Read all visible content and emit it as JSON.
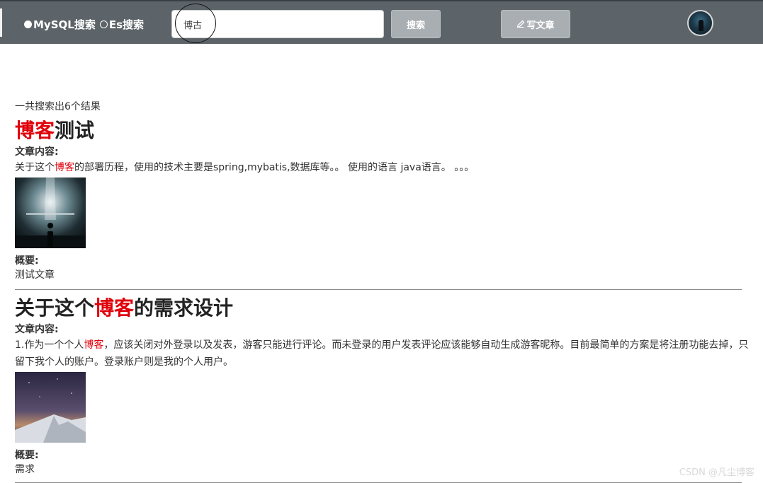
{
  "navbar": {
    "mode_options": [
      {
        "label": "MySQL搜索",
        "selected": true
      },
      {
        "label": "Es搜索",
        "selected": false
      }
    ],
    "search_value": "博古",
    "search_button": "搜索",
    "write_button": "写文章",
    "write_icon": "pencil-icon",
    "bg_color": "#5d6469"
  },
  "results": {
    "count_text": "一共搜索出6个结果",
    "highlight_color": "#e0000b",
    "articles": [
      {
        "title_parts": [
          {
            "text": "博客",
            "hl": true
          },
          {
            "text": "测试",
            "hl": false
          }
        ],
        "content_label": "文章内容:",
        "content_parts": [
          {
            "text": "关于这个",
            "hl": false
          },
          {
            "text": "博客",
            "hl": true
          },
          {
            "text": "的部署历程，使用的技术主要是spring,mybatis,数据库等。。 使用的语言 java语言。 。。。",
            "hl": false
          }
        ],
        "summary_label": "概要:",
        "summary": "测试文章"
      },
      {
        "title_parts": [
          {
            "text": "关于这个",
            "hl": false
          },
          {
            "text": "博客",
            "hl": true
          },
          {
            "text": "的需求设计",
            "hl": false
          }
        ],
        "content_label": "文章内容:",
        "content_parts": [
          {
            "text": "1.作为一个个人",
            "hl": false
          },
          {
            "text": "博客",
            "hl": true
          },
          {
            "text": "，应该关闭对外登录以及发表，游客只能进行评论。而未登录的用户发表评论应该能够自动生成游客昵称。目前最简单的方案是将注册功能去掉，只留下我个人的账户。登录账户则是我的个人用户。",
            "hl": false
          }
        ],
        "summary_label": "概要:",
        "summary": "需求"
      }
    ]
  },
  "watermark": "CSDN @凡尘博客"
}
